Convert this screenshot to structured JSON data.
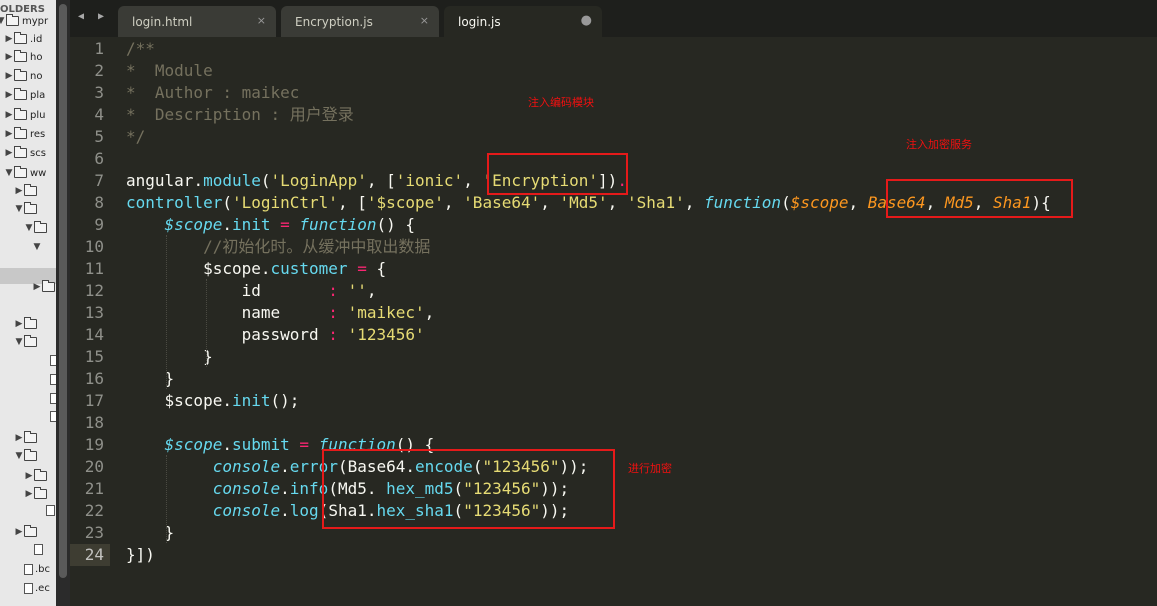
{
  "sidebar": {
    "header": "OLDERS",
    "rows": [
      {
        "tri": "▼",
        "type": "folder",
        "label": "mypr"
      },
      {
        "tri": "▶",
        "type": "folder",
        "label": ".id"
      },
      {
        "tri": "▶",
        "type": "folder",
        "label": "ho"
      },
      {
        "tri": "▶",
        "type": "folder",
        "label": "no"
      },
      {
        "tri": "▶",
        "type": "folder",
        "label": "pla"
      },
      {
        "tri": "▶",
        "type": "folder",
        "label": "plu"
      },
      {
        "tri": "▶",
        "type": "folder",
        "label": "res"
      },
      {
        "tri": "▶",
        "type": "folder",
        "label": "scs"
      },
      {
        "tri": "▼",
        "type": "folder",
        "label": "ww"
      },
      {
        "tri": "▶",
        "type": "folder",
        "label": ""
      },
      {
        "tri": "▼",
        "type": "folder",
        "label": ""
      },
      {
        "tri": "▼",
        "type": "folder",
        "label": ""
      },
      {
        "tri": "▼",
        "type": "none",
        "label": ""
      },
      {
        "tri": "▶",
        "type": "folder",
        "label": ""
      },
      {
        "tri": "▶",
        "type": "folder",
        "label": ""
      },
      {
        "tri": "▼",
        "type": "folder",
        "label": ""
      },
      {
        "tri": "",
        "type": "file",
        "label": ""
      },
      {
        "tri": "",
        "type": "file",
        "label": ""
      },
      {
        "tri": "",
        "type": "file",
        "label": ""
      },
      {
        "tri": "",
        "type": "file",
        "label": ""
      },
      {
        "tri": "▶",
        "type": "folder",
        "label": ""
      },
      {
        "tri": "▼",
        "type": "folder",
        "label": ""
      },
      {
        "tri": "▶",
        "type": "folder",
        "label": ""
      },
      {
        "tri": "▶",
        "type": "folder",
        "label": ""
      },
      {
        "tri": "",
        "type": "file",
        "label": ""
      },
      {
        "tri": "▶",
        "type": "folder",
        "label": ""
      },
      {
        "tri": "",
        "type": "file",
        "label": ""
      },
      {
        "tri": "",
        "type": "file",
        "label": ".bc"
      },
      {
        "tri": "",
        "type": "file",
        "label": ".ec"
      }
    ]
  },
  "tabs": [
    {
      "label": "login.html",
      "close": "×",
      "active": false
    },
    {
      "label": "Encryption.js",
      "close": "×",
      "active": false
    },
    {
      "label": "login.js",
      "close": "●",
      "active": true
    }
  ],
  "nav_arrows": "◀ ▶",
  "editor": {
    "current_line": 24,
    "lines": [
      [
        {
          "t": "/**",
          "c": "c"
        }
      ],
      [
        {
          "t": "*  Module",
          "c": "c"
        }
      ],
      [
        {
          "t": "*  Author : maikec",
          "c": "c"
        }
      ],
      [
        {
          "t": "*  Description : 用户登录",
          "c": "c"
        }
      ],
      [
        {
          "t": "*/",
          "c": "c"
        }
      ],
      [],
      [
        {
          "t": "angular",
          "c": ""
        },
        {
          "t": ".",
          "c": ""
        },
        {
          "t": "module",
          "c": "sp"
        },
        {
          "t": "(",
          "c": ""
        },
        {
          "t": "'LoginApp'",
          "c": "s"
        },
        {
          "t": ", [",
          "c": ""
        },
        {
          "t": "'ionic'",
          "c": "s"
        },
        {
          "t": ", ",
          "c": ""
        },
        {
          "t": "'Encryption'",
          "c": "s"
        },
        {
          "t": "])",
          "c": ""
        },
        {
          "t": ".",
          "c": "op"
        }
      ],
      [
        {
          "t": "controller",
          "c": "sp"
        },
        {
          "t": "(",
          "c": ""
        },
        {
          "t": "'LoginCtrl'",
          "c": "s"
        },
        {
          "t": ", [",
          "c": ""
        },
        {
          "t": "'$scope'",
          "c": "s"
        },
        {
          "t": ", ",
          "c": ""
        },
        {
          "t": "'Base64'",
          "c": "s"
        },
        {
          "t": ", ",
          "c": ""
        },
        {
          "t": "'Md5'",
          "c": "s"
        },
        {
          "t": ", ",
          "c": ""
        },
        {
          "t": "'Sha1'",
          "c": "s"
        },
        {
          "t": ", ",
          "c": ""
        },
        {
          "t": "function",
          "c": "kw"
        },
        {
          "t": "(",
          "c": ""
        },
        {
          "t": "$scope",
          "c": "pa"
        },
        {
          "t": ", ",
          "c": ""
        },
        {
          "t": "Base64",
          "c": "pa"
        },
        {
          "t": ", ",
          "c": ""
        },
        {
          "t": "Md5",
          "c": "pa"
        },
        {
          "t": ", ",
          "c": ""
        },
        {
          "t": "Sha1",
          "c": "pa"
        },
        {
          "t": "){",
          "c": ""
        }
      ],
      [
        {
          "t": "    ",
          "c": ""
        },
        {
          "t": "$scope",
          "c": "kw"
        },
        {
          "t": ".",
          "c": ""
        },
        {
          "t": "init",
          "c": "sp"
        },
        {
          "t": " ",
          "c": ""
        },
        {
          "t": "=",
          "c": "op"
        },
        {
          "t": " ",
          "c": ""
        },
        {
          "t": "function",
          "c": "kw"
        },
        {
          "t": "() {",
          "c": ""
        }
      ],
      [
        {
          "t": "        //初始化时。从缓冲中取出数据",
          "c": "c"
        }
      ],
      [
        {
          "t": "        $scope",
          "c": ""
        },
        {
          "t": ".",
          "c": ""
        },
        {
          "t": "customer",
          "c": "sp"
        },
        {
          "t": " ",
          "c": ""
        },
        {
          "t": "=",
          "c": "op"
        },
        {
          "t": " {",
          "c": ""
        }
      ],
      [
        {
          "t": "            id       ",
          "c": ""
        },
        {
          "t": ":",
          "c": "op"
        },
        {
          "t": " ",
          "c": ""
        },
        {
          "t": "''",
          "c": "s"
        },
        {
          "t": ",",
          "c": ""
        }
      ],
      [
        {
          "t": "            name     ",
          "c": ""
        },
        {
          "t": ":",
          "c": "op"
        },
        {
          "t": " ",
          "c": ""
        },
        {
          "t": "'maikec'",
          "c": "s"
        },
        {
          "t": ",",
          "c": ""
        }
      ],
      [
        {
          "t": "            password ",
          "c": ""
        },
        {
          "t": ":",
          "c": "op"
        },
        {
          "t": " ",
          "c": ""
        },
        {
          "t": "'123456'",
          "c": "s"
        }
      ],
      [
        {
          "t": "        }",
          "c": ""
        }
      ],
      [
        {
          "t": "    }",
          "c": ""
        }
      ],
      [
        {
          "t": "    $scope",
          "c": ""
        },
        {
          "t": ".",
          "c": ""
        },
        {
          "t": "init",
          "c": "sp"
        },
        {
          "t": "();",
          "c": ""
        }
      ],
      [],
      [
        {
          "t": "    ",
          "c": ""
        },
        {
          "t": "$scope",
          "c": "kw"
        },
        {
          "t": ".",
          "c": ""
        },
        {
          "t": "submit",
          "c": "sp"
        },
        {
          "t": " ",
          "c": ""
        },
        {
          "t": "=",
          "c": "op"
        },
        {
          "t": " ",
          "c": ""
        },
        {
          "t": "function",
          "c": "kw"
        },
        {
          "t": "() {",
          "c": ""
        }
      ],
      [
        {
          "t": "         ",
          "c": ""
        },
        {
          "t": "console",
          "c": "kw"
        },
        {
          "t": ".",
          "c": ""
        },
        {
          "t": "error",
          "c": "sp"
        },
        {
          "t": "(Base64.",
          "c": ""
        },
        {
          "t": "encode",
          "c": "sp"
        },
        {
          "t": "(",
          "c": ""
        },
        {
          "t": "\"123456\"",
          "c": "s"
        },
        {
          "t": "));",
          "c": ""
        }
      ],
      [
        {
          "t": "         ",
          "c": ""
        },
        {
          "t": "console",
          "c": "kw"
        },
        {
          "t": ".",
          "c": ""
        },
        {
          "t": "info",
          "c": "sp"
        },
        {
          "t": "(Md5. ",
          "c": ""
        },
        {
          "t": "hex_md5",
          "c": "sp"
        },
        {
          "t": "(",
          "c": ""
        },
        {
          "t": "\"123456\"",
          "c": "s"
        },
        {
          "t": "));",
          "c": ""
        }
      ],
      [
        {
          "t": "         ",
          "c": ""
        },
        {
          "t": "console",
          "c": "kw"
        },
        {
          "t": ".",
          "c": ""
        },
        {
          "t": "log",
          "c": "sp"
        },
        {
          "t": "(Sha1.",
          "c": ""
        },
        {
          "t": "hex_sha1",
          "c": "sp"
        },
        {
          "t": "(",
          "c": ""
        },
        {
          "t": "\"123456\"",
          "c": "s"
        },
        {
          "t": "));",
          "c": ""
        }
      ],
      [
        {
          "t": "    }",
          "c": ""
        }
      ],
      [
        {
          "t": "}])",
          "c": ""
        }
      ]
    ]
  },
  "annotations": {
    "inject_encoding_module": "注入编码模块",
    "inject_encryption_service": "注入加密服务",
    "perform_encryption": "进行加密",
    "highlight_color": "#e51a1a"
  }
}
